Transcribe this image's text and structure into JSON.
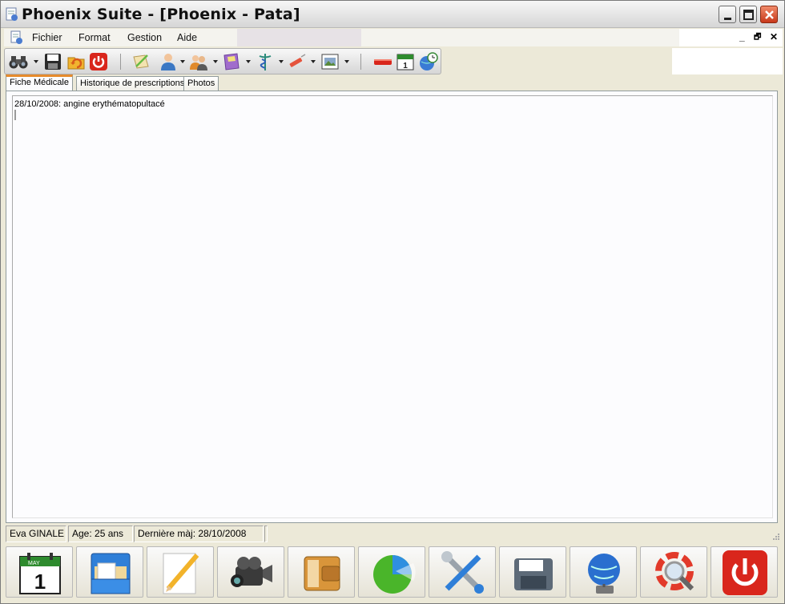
{
  "window": {
    "title": "Phoenix Suite - [Phoenix - Pata]"
  },
  "menu": {
    "items": [
      "Fichier",
      "Format",
      "Gestion",
      "Aide"
    ],
    "mdi_controls": [
      "_",
      "🗗",
      "✕"
    ]
  },
  "toolbar": {
    "buttons": [
      {
        "icon": "binoculars-icon",
        "dropdown": true
      },
      {
        "icon": "floppy-save-icon",
        "dropdown": false
      },
      {
        "icon": "refresh-folder-icon",
        "dropdown": false
      },
      {
        "icon": "power-icon",
        "dropdown": false
      },
      {
        "icon": "pen-paper-icon",
        "dropdown": false
      },
      {
        "icon": "patient-icon",
        "dropdown": true
      },
      {
        "icon": "users-icon",
        "dropdown": true
      },
      {
        "icon": "book-icon",
        "dropdown": true
      },
      {
        "icon": "caduceus-icon",
        "dropdown": true
      },
      {
        "icon": "syringe-icon",
        "dropdown": true
      },
      {
        "icon": "image-icon",
        "dropdown": true
      },
      {
        "icon": "minus-red-icon",
        "dropdown": false
      },
      {
        "icon": "calendar-icon",
        "dropdown": false
      },
      {
        "icon": "globe-clock-icon",
        "dropdown": false
      }
    ],
    "accent_colors": {
      "power": "#d9261c",
      "calendar": "#2e8b2e",
      "syringe": "#e5533c"
    }
  },
  "tabs": [
    {
      "label": "Fiche Médicale",
      "active": true
    },
    {
      "label": "Historique de prescriptions",
      "active": false
    },
    {
      "label": "Photos",
      "active": false
    }
  ],
  "content": {
    "text_line": "28/10/2008: angine erythématopultacé"
  },
  "status": {
    "patient_name": "Eva GINALE",
    "age": "Age: 25 ans",
    "last_update": "Dernière màj: 28/10/2008"
  },
  "launcher": {
    "buttons": [
      {
        "icon": "calendar-launch-icon",
        "cal_month": "MAY",
        "cal_day": "1"
      },
      {
        "icon": "file-drawer-icon"
      },
      {
        "icon": "notepad-pencil-icon"
      },
      {
        "icon": "video-camera-icon"
      },
      {
        "icon": "wallet-icon"
      },
      {
        "icon": "pie-chart-icon"
      },
      {
        "icon": "tools-icon"
      },
      {
        "icon": "floppy-disk-icon"
      },
      {
        "icon": "globe-network-icon"
      },
      {
        "icon": "lifebuoy-search-icon"
      },
      {
        "icon": "power-off-icon"
      }
    ]
  }
}
